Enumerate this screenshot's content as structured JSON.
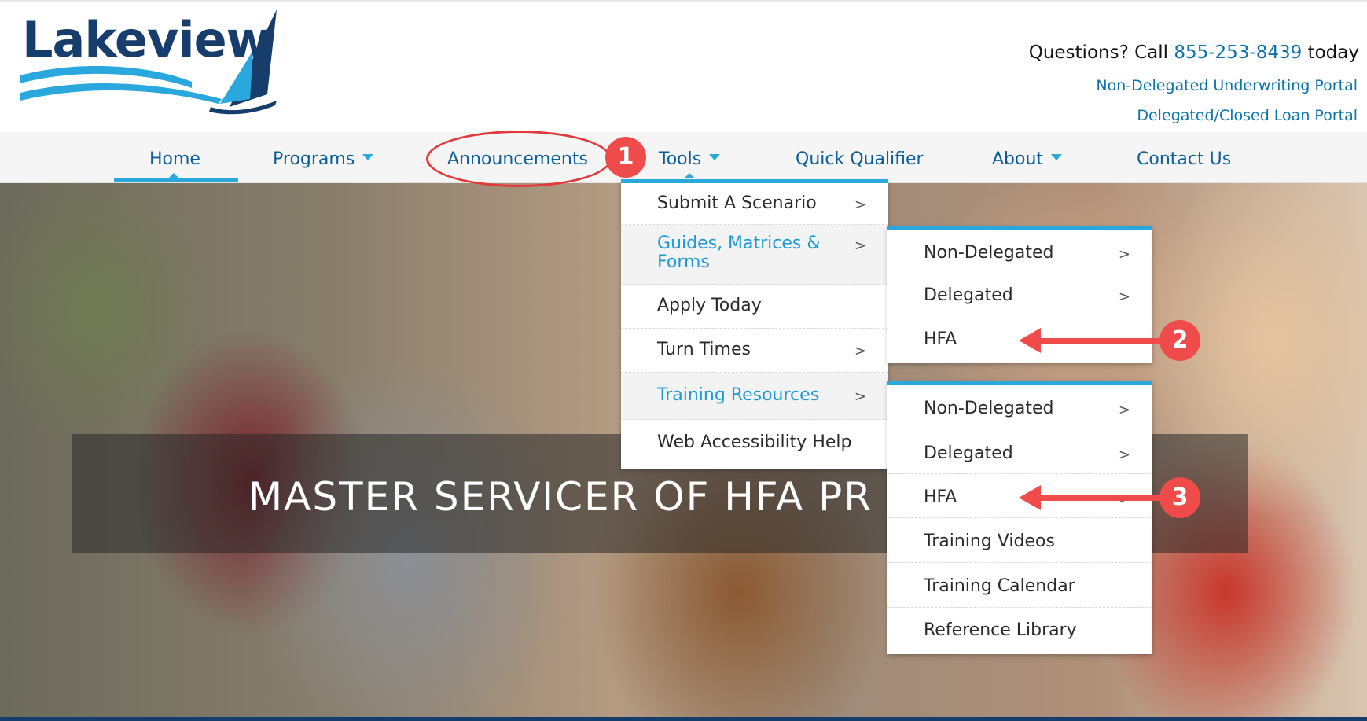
{
  "header": {
    "logo_text": "Lakeview",
    "questions_prefix": "Questions? Call ",
    "phone": "855-253-8439",
    "questions_suffix": " today",
    "portal_links": [
      "Non-Delegated Underwriting Portal",
      "Delegated/Closed Loan Portal"
    ]
  },
  "nav": {
    "items": [
      {
        "label": "Home",
        "caret": false,
        "active": true
      },
      {
        "label": "Programs",
        "caret": true
      },
      {
        "label": "Announcements",
        "caret": false
      },
      {
        "label": "Tools",
        "caret": true
      },
      {
        "label": "Quick Qualifier",
        "caret": false
      },
      {
        "label": "About",
        "caret": true
      },
      {
        "label": "Contact Us",
        "caret": false
      }
    ]
  },
  "tools_menu": {
    "items": [
      {
        "label": "Submit A Scenario",
        "chevron": ">"
      },
      {
        "label": "Guides, Matrices & Forms",
        "chevron": ">",
        "highlighted": true
      },
      {
        "label": "Apply Today",
        "chevron": ""
      },
      {
        "label": "Turn Times",
        "chevron": ">"
      },
      {
        "label": "Training Resources",
        "chevron": ">",
        "highlighted": true
      },
      {
        "label": "Web Accessibility Help",
        "chevron": ""
      }
    ]
  },
  "guides_submenu": {
    "items": [
      {
        "label": "Non-Delegated",
        "chevron": ">"
      },
      {
        "label": "Delegated",
        "chevron": ">"
      },
      {
        "label": "HFA",
        "chevron": ""
      }
    ]
  },
  "training_submenu": {
    "items": [
      {
        "label": "Non-Delegated",
        "chevron": ">"
      },
      {
        "label": "Delegated",
        "chevron": ">"
      },
      {
        "label": "HFA",
        "chevron": ">"
      },
      {
        "label": "Training Videos",
        "chevron": ""
      },
      {
        "label": "Training Calendar",
        "chevron": ""
      },
      {
        "label": "Reference Library",
        "chevron": ""
      }
    ]
  },
  "hero": {
    "title": "MASTER SERVICER OF HFA PR"
  },
  "annotations": {
    "badges": [
      "1",
      "2",
      "3"
    ],
    "color": "#ef4b4b"
  },
  "colors": {
    "brand_navy": "#163d6c",
    "link_blue": "#0c73ad",
    "accent_blue": "#2aa8dd"
  }
}
